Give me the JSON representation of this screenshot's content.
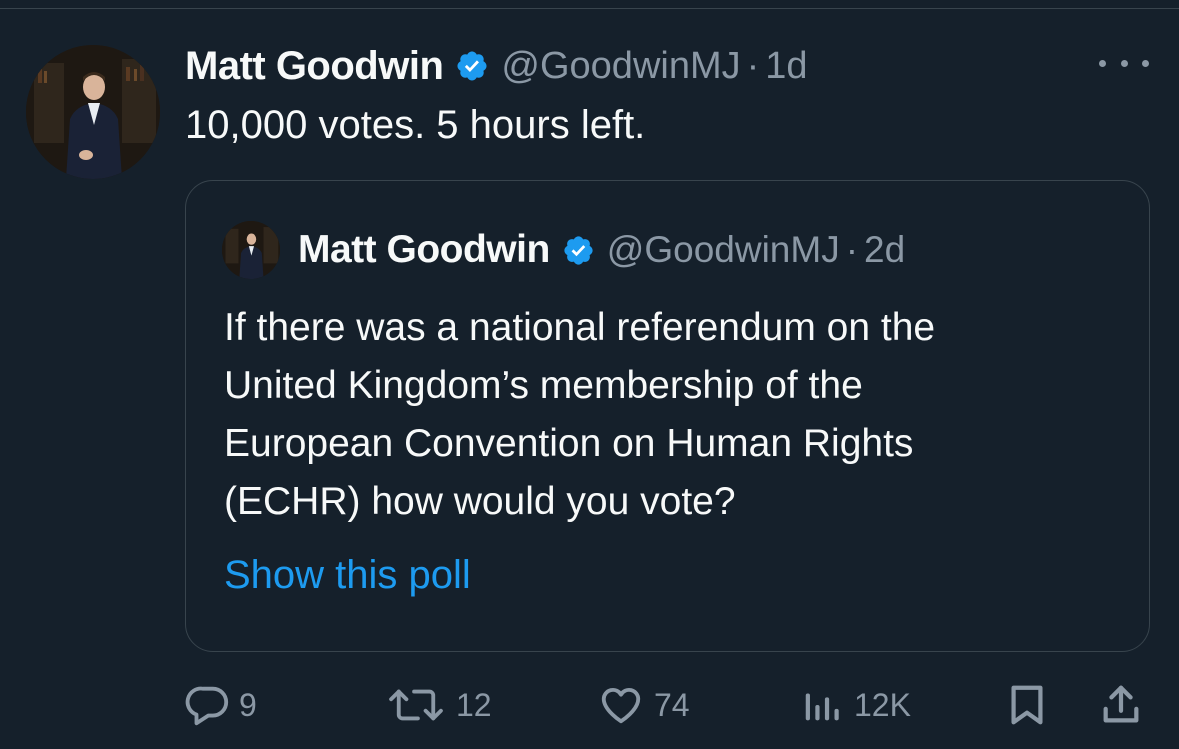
{
  "tweet": {
    "author_name": "Matt Goodwin",
    "handle": "@GoodwinMJ",
    "separator": "·",
    "time": "1d",
    "text": "10,000 votes. 5 hours left."
  },
  "quoted_tweet": {
    "author_name": "Matt Goodwin",
    "handle": "@GoodwinMJ",
    "separator": "·",
    "time": "2d",
    "text_lines": [
      "If there was a national referendum on the",
      "United Kingdom’s membership of the",
      "European Convention on Human Rights",
      "(ECHR) how would you vote?"
    ],
    "show_poll_label": "Show this poll"
  },
  "actions": {
    "replies": "9",
    "reposts": "12",
    "likes": "74",
    "views": "12K"
  },
  "colors": {
    "background": "#15202b",
    "accent": "#1d9bf0",
    "muted": "#8b98a5",
    "border": "#38444d"
  },
  "icons": [
    "verified-badge-icon",
    "more-icon",
    "reply-icon",
    "repost-icon",
    "like-icon",
    "views-icon",
    "bookmark-icon",
    "share-icon"
  ]
}
